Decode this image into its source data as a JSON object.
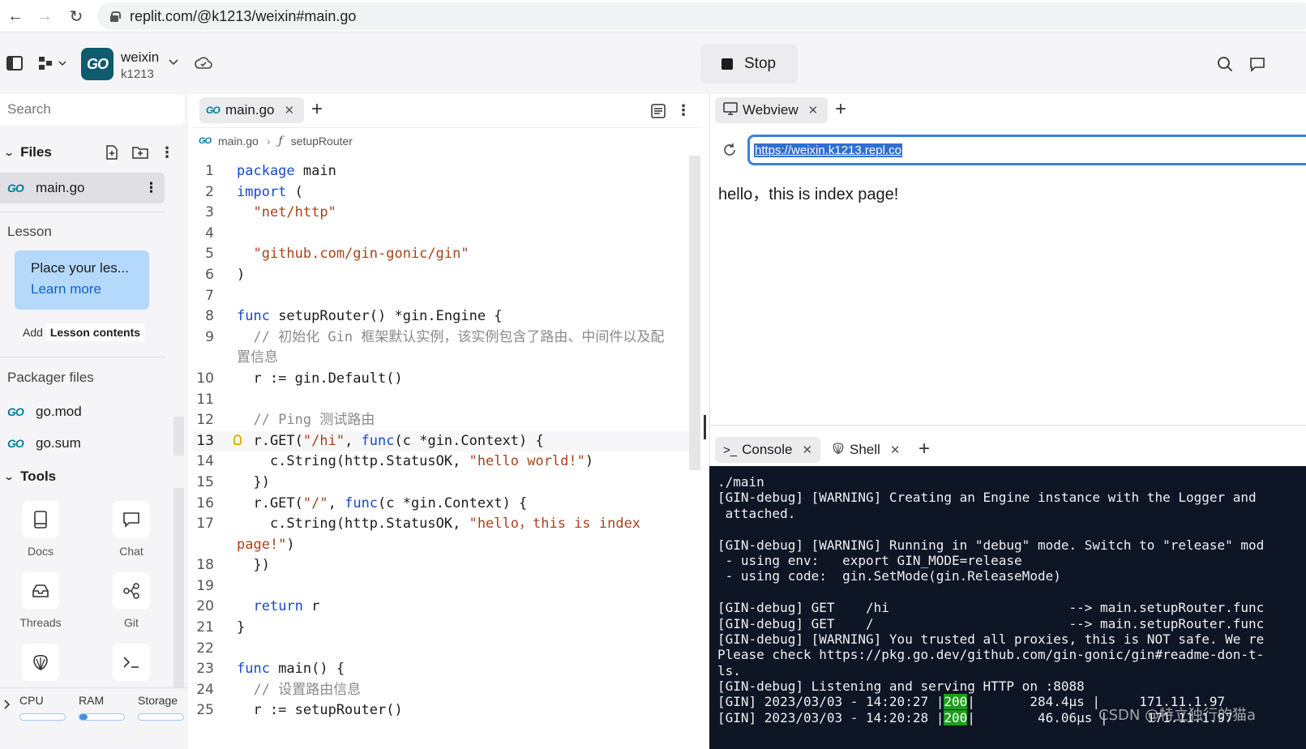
{
  "browser": {
    "url": "replit.com/@k1213/weixin#main.go"
  },
  "header": {
    "repl_name": "weixin",
    "repl_owner": "k1213",
    "logo_text": "GO",
    "stop_label": "Stop"
  },
  "sidebar": {
    "search_placeholder": "Search",
    "files_title": "Files",
    "files": [
      {
        "name": "main.go"
      }
    ],
    "lesson_title": "Lesson",
    "lesson_card_text": "Place your les...",
    "lesson_card_link": "Learn more",
    "add_label": "Add",
    "lesson_contents": "Lesson contents",
    "packager_title": "Packager files",
    "packager_files": [
      {
        "name": "go.mod"
      },
      {
        "name": "go.sum"
      }
    ],
    "tools_title": "Tools",
    "tools": [
      {
        "label": "Docs",
        "icon": "docs-icon"
      },
      {
        "label": "Chat",
        "icon": "chat-icon"
      },
      {
        "label": "Threads",
        "icon": "threads-icon"
      },
      {
        "label": "Git",
        "icon": "git-icon"
      }
    ],
    "resources": {
      "cpu": "CPU",
      "ram": "RAM",
      "storage": "Storage",
      "ram_level": 0.18
    }
  },
  "editor": {
    "tab_label": "main.go",
    "breadcrumb_file": "main.go",
    "breadcrumb_fn": "setupRouter",
    "active_line": 13
  },
  "webview": {
    "tab_label": "Webview",
    "url": "https://weixin.k1213.repl.co",
    "content": "hello，this is index page!"
  },
  "console": {
    "console_tab": "Console",
    "shell_tab": "Shell",
    "lines": [
      "./main",
      "[GIN-debug] [WARNING] Creating an Engine instance with the Logger and",
      " attached.",
      "",
      "[GIN-debug] [WARNING] Running in \"debug\" mode. Switch to \"release\" mod",
      " - using env:   export GIN_MODE=release",
      " - using code:  gin.SetMode(gin.ReleaseMode)",
      "",
      "[GIN-debug] GET    /hi                       --> main.setupRouter.func",
      "[GIN-debug] GET    /                         --> main.setupRouter.func",
      "[GIN-debug] [WARNING] You trusted all proxies, this is NOT safe. We re",
      "Please check https://pkg.go.dev/github.com/gin-gonic/gin#readme-don-t-",
      "ls.",
      "[GIN-debug] Listening and serving HTTP on :8088"
    ],
    "log_lines": [
      {
        "prefix": "[GIN] 2023/03/03 - 14:20:27 |",
        "status": "200",
        "rest": "|       284.4µs |     171.11.1.97"
      },
      {
        "prefix": "[GIN] 2023/03/03 - 14:20:28 |",
        "status": "200",
        "rest": "|        46.06µs |     171.11.1.97"
      }
    ]
  },
  "watermark": "CSDN @特立独行的猫a"
}
